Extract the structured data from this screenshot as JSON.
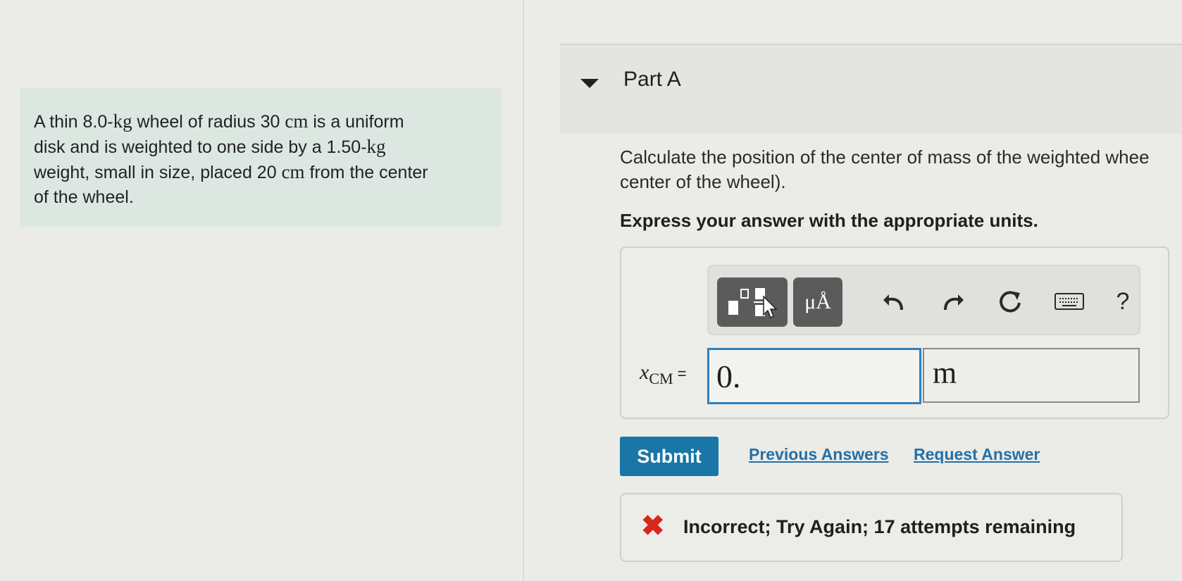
{
  "problem": {
    "line1_pre": "A thin 8.0-",
    "unit_kg": "kg",
    "line1_mid": " wheel of radius 30 ",
    "unit_cm": "cm",
    "line1_post": " is a uniform",
    "line2_pre": "disk and is weighted to one side by a 1.50-",
    "line3_pre": "weight, small in size, placed 20 ",
    "line3_post": " from the center",
    "line4": "of the wheel."
  },
  "part": {
    "title": "Part A",
    "question_line1": "Calculate the position of the center of mass of the weighted whee",
    "question_line2": "center of the wheel).",
    "instruction": "Express your answer with the appropriate units."
  },
  "toolbar": {
    "units_label": "μÅ",
    "help_label": "?"
  },
  "answer": {
    "variable": "x",
    "subscript": "CM",
    "equals": "=",
    "value": "0.",
    "unit": "m"
  },
  "actions": {
    "submit_label": "Submit",
    "previous_answers_label": "Previous Answers",
    "request_answer_label": "Request Answer"
  },
  "feedback": {
    "icon": "✖",
    "message": "Incorrect; Try Again; 17 attempts remaining"
  }
}
